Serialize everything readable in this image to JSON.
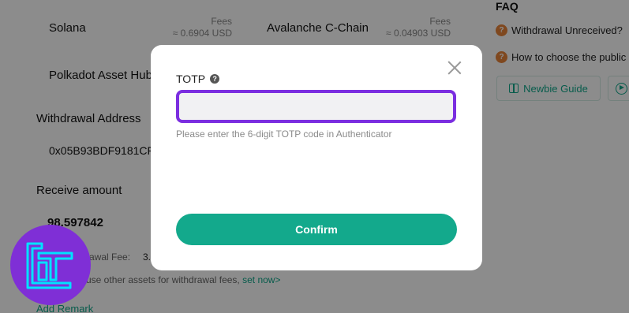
{
  "networks": [
    {
      "name": "Solana",
      "fees_label": "Fees",
      "fees_value": "≈ 0.6904 USD"
    },
    {
      "name": "Avalanche C-Chain",
      "fees_label": "Fees",
      "fees_value": "≈ 0.04903 USD"
    },
    {
      "name": "Polkadot Asset Hub"
    }
  ],
  "withdrawal": {
    "address_label": "Withdrawal Address",
    "address_value": "0x05B93BDF9181CF",
    "receive_label": "Receive amount",
    "receive_value": "98.597842",
    "fee_label": "rawal Fee:",
    "fee_value": "3.",
    "other_assets_text": "use other assets for withdrawal fees,",
    "set_now_link": "set now>",
    "add_remark": "Add Remark"
  },
  "faq": {
    "title": "FAQ",
    "items": [
      "Withdrawal Unreceived?",
      "How to choose the public"
    ],
    "guide_button": "Newbie Guide"
  },
  "modal": {
    "label": "TOTP",
    "input_value": "",
    "hint": "Please enter the 6-digit TOTP code in Authenticator",
    "confirm": "Confirm"
  },
  "icons": {
    "close": "close-icon",
    "help": "help-icon",
    "faq": "question-icon",
    "guide": "book-icon",
    "video": "play-icon"
  },
  "colors": {
    "accent": "#13a98c",
    "focus_border": "#7b2ee0",
    "faq_icon": "#e8833a",
    "logo_bg": "#7f2fd6",
    "logo_stroke": "#00e1ff"
  }
}
